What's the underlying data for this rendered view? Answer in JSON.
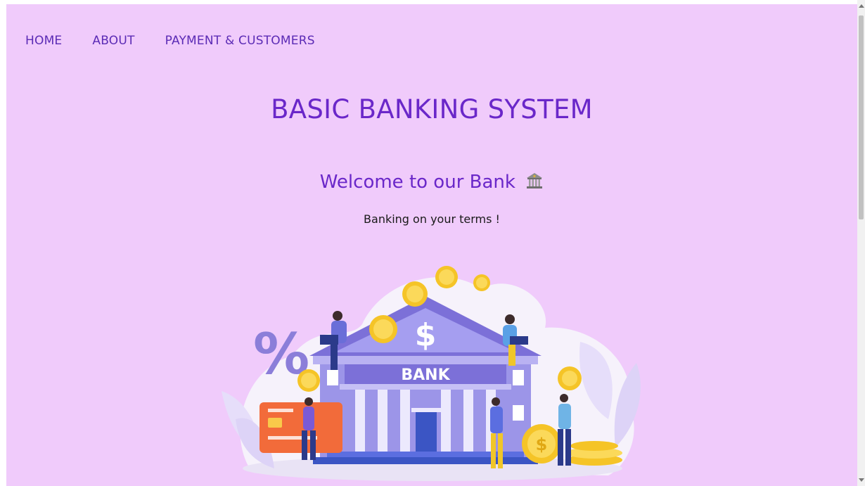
{
  "nav": {
    "items": [
      {
        "label": "HOME"
      },
      {
        "label": "ABOUT"
      },
      {
        "label": "PAYMENT & CUSTOMERS"
      }
    ]
  },
  "hero": {
    "title": "BASIC BANKING SYSTEM",
    "welcome": "Welcome to our Bank",
    "welcome_icon": "bank-building-emoji",
    "tagline": "Banking on your terms !"
  },
  "illustration": {
    "bank_sign": "BANK",
    "dollar_sign": "$",
    "percent_sign": "%"
  },
  "colors": {
    "page_bg": "#f0cbfb",
    "accent": "#6a27c9",
    "nav": "#5b2bb5"
  }
}
